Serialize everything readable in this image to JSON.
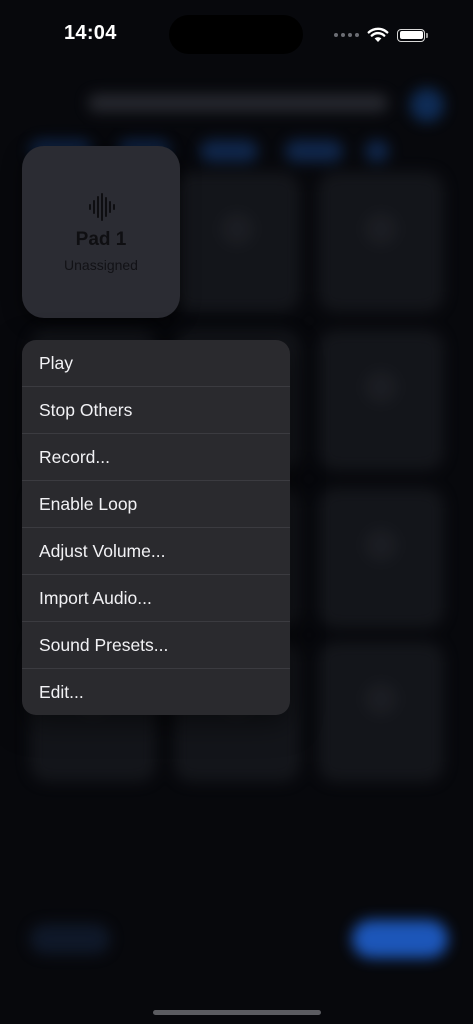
{
  "status_bar": {
    "time": "14:04",
    "wifi_icon": "wifi-icon",
    "battery_icon": "battery-icon"
  },
  "pad_preview": {
    "icon": "waveform-icon",
    "title": "Pad 1",
    "subtitle": "Unassigned"
  },
  "context_menu": {
    "items": [
      {
        "label": "Play"
      },
      {
        "label": "Stop Others"
      },
      {
        "label": "Record..."
      },
      {
        "label": "Enable Loop"
      },
      {
        "label": "Adjust Volume..."
      },
      {
        "label": "Import Audio..."
      },
      {
        "label": "Sound Presets..."
      },
      {
        "label": "Edit..."
      }
    ]
  },
  "colors": {
    "background": "#07080c",
    "menu_background": "#2a2a2e",
    "pad_background": "#2b2c33",
    "accent": "#1f5fcc"
  }
}
